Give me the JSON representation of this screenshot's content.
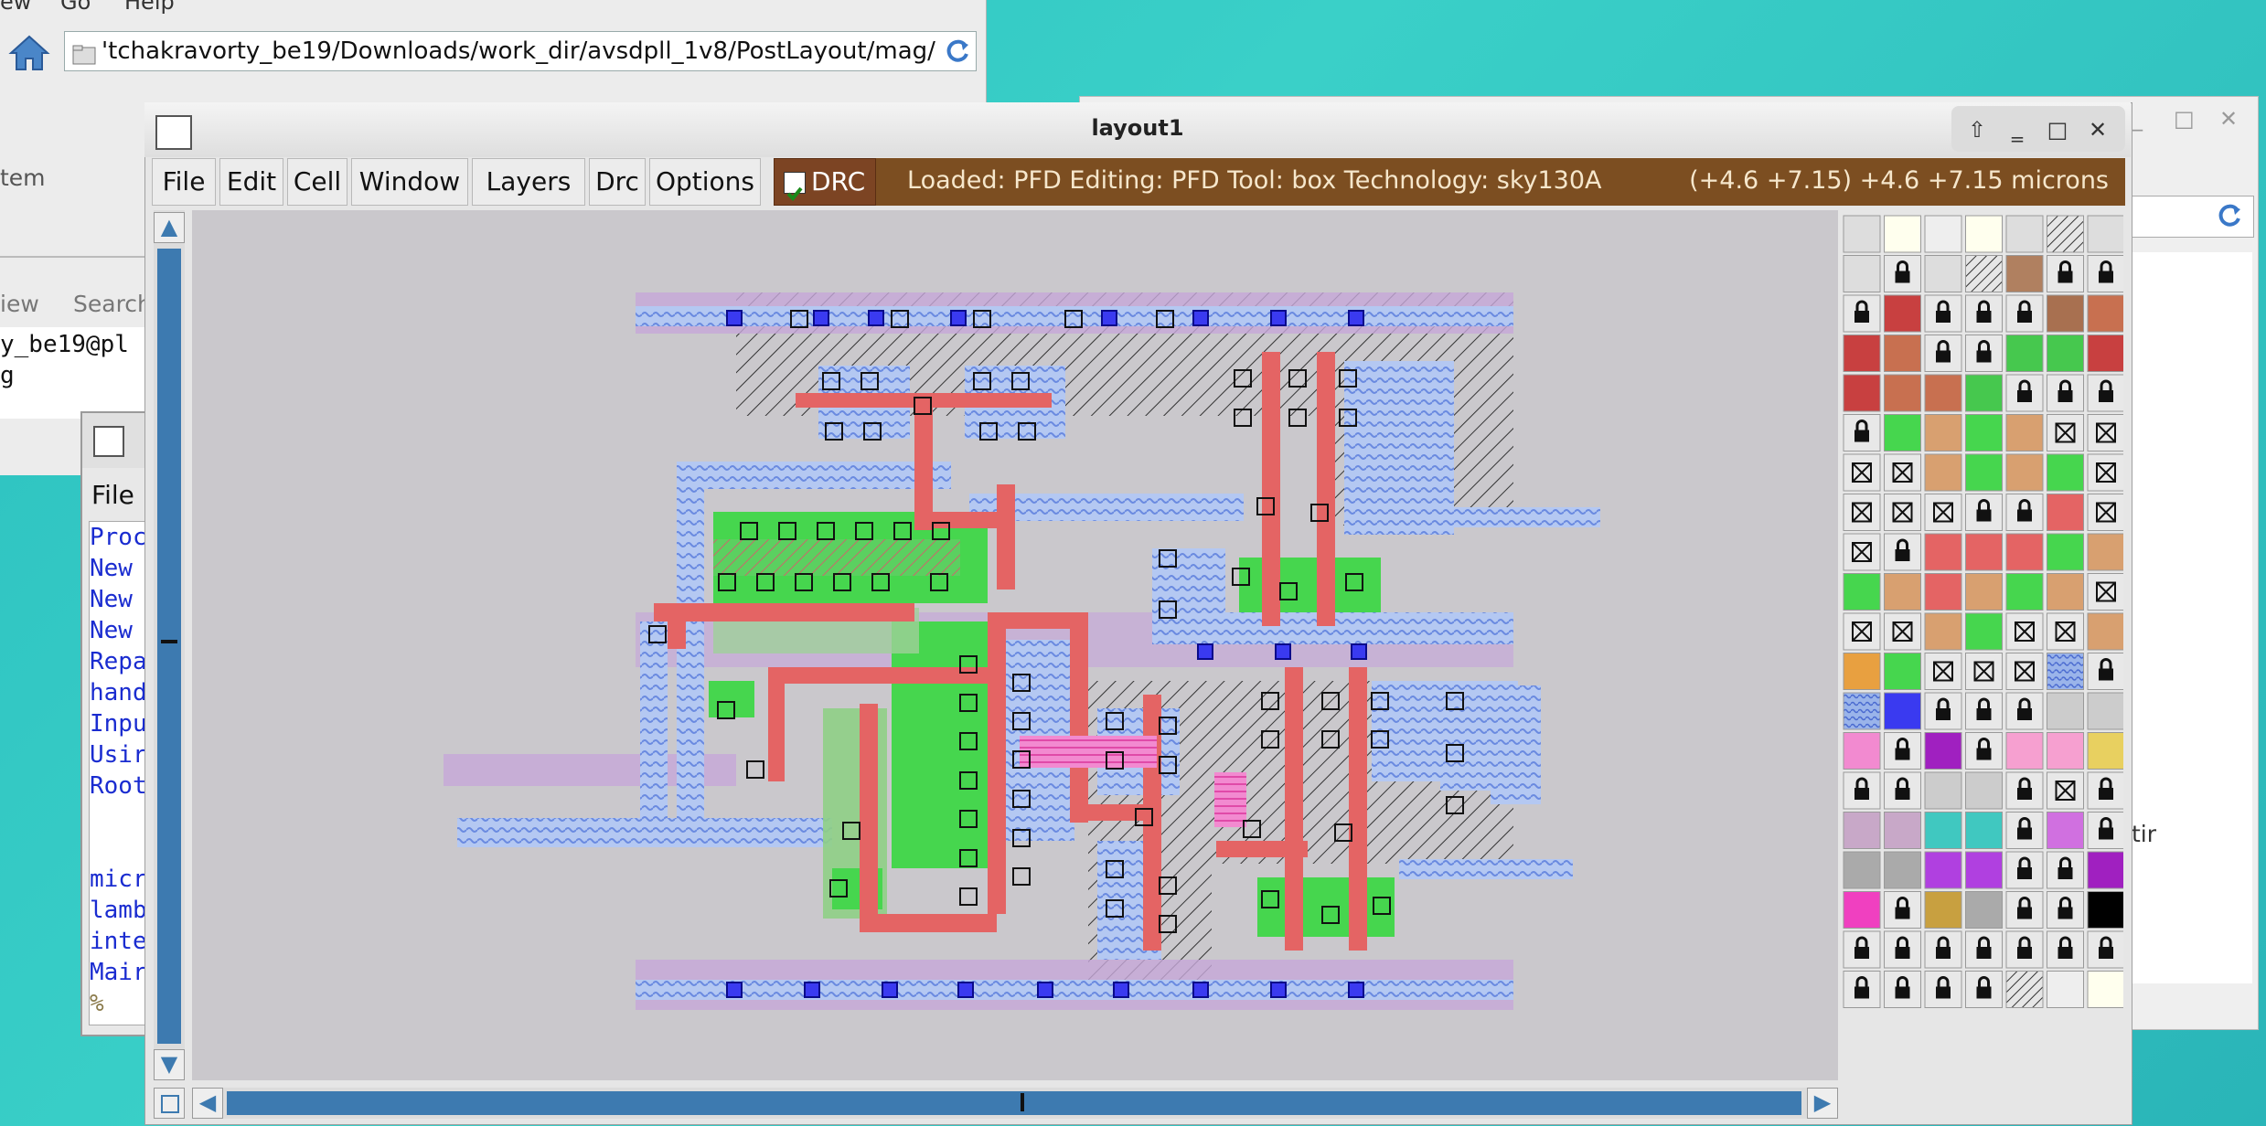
{
  "file_manager": {
    "menu": [
      "ew",
      "Go",
      "Help"
    ],
    "address": "'tchakravorty_be19/Downloads/work_dir/avsdpll_1v8/PostLayout/mag/",
    "sidebar_item": "tem",
    "toolbar_items": [
      "iew",
      "Search"
    ]
  },
  "terminal": {
    "lines": [
      "y_be19@pl",
      "g"
    ]
  },
  "tk_console": {
    "menu_file": "File",
    "lines": [
      "Proc",
      "New",
      "New",
      "New",
      "Repa",
      "hand",
      "Inpu",
      "Usir",
      "Root",
      "",
      "",
      "micr",
      "lamb",
      "inte",
      "Mair",
      "%"
    ]
  },
  "right_window": {
    "text": "tir"
  },
  "layout_window": {
    "title": "layout1",
    "menu": [
      "File",
      "Edit",
      "Cell",
      "Window",
      "Layers",
      "Drc",
      "Options"
    ],
    "drc_label": "DRC",
    "drc_checked": true,
    "status_left": "Loaded: PFD Editing: PFD Tool: box  Technology: sky130A",
    "status_right": "(+4.6 +7.15) +4.6 +7.15 microns"
  },
  "colors": {
    "metal1": "#9ab4ea",
    "poly": "#e46464",
    "diffusion": "#46d64e",
    "local_interconnect": "#c6a8d8",
    "status_bg": "#7c4e21",
    "scroll": "#3d7ab0"
  }
}
